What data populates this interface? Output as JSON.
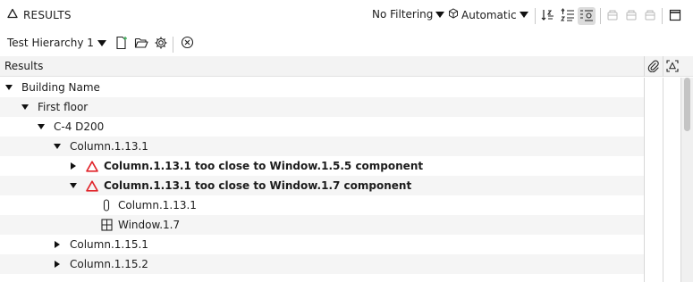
{
  "header": {
    "title": "RESULTS",
    "filter_label": "No Filtering",
    "mode_label": "Automatic"
  },
  "toolbar": {
    "hierarchy_label": "Test Hierarchy 1"
  },
  "table": {
    "column_title": "Results"
  },
  "tree": {
    "rows": [
      {
        "label": "Building Name"
      },
      {
        "label": "First floor"
      },
      {
        "label": "C-4 D200"
      },
      {
        "label": "Column.1.13.1"
      },
      {
        "label": "Column.1.13.1 too close to Window.1.5.5 component"
      },
      {
        "label": "Column.1.13.1 too close to Window.1.7 component"
      },
      {
        "label": "Column.1.13.1"
      },
      {
        "label": "Window.1.7"
      },
      {
        "label": "Column.1.15.1"
      },
      {
        "label": "Column.1.15.2"
      }
    ]
  },
  "colors": {
    "warning": "#e0242a",
    "active_button_bg": "#dcdcdc",
    "header_bg": "#f3f3f3",
    "alt_row_bg": "#f5f5f5"
  }
}
